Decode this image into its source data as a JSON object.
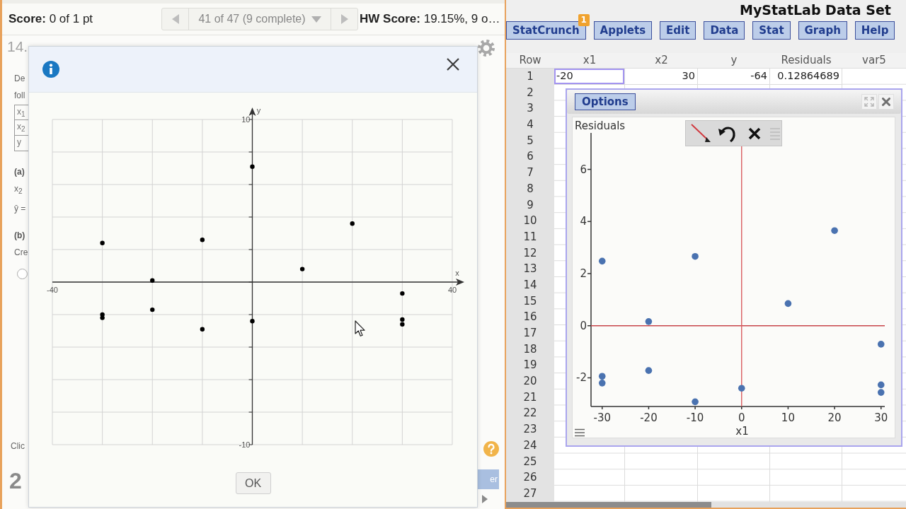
{
  "assignment_bar": {
    "score": "**Score:** 0 of 1 pt",
    "question_picker": "41 of 47 (9 complete)",
    "hw_score": "**HW Score:** 19.15%, 9 o…"
  },
  "question": {
    "number": "14.",
    "items": [
      {
        "kind": "text",
        "text": "De"
      },
      {
        "kind": "text",
        "text": "foll"
      },
      {
        "kind": "table",
        "cells": [
          "x$_{1}$",
          "x$_{2}$",
          "y"
        ]
      },
      {
        "kind": "part",
        "text": "(a)"
      },
      {
        "kind": "text",
        "text": "x$_{2}$"
      },
      {
        "kind": "text",
        "text": "ŷ ="
      },
      {
        "kind": "part",
        "text": "(b)"
      },
      {
        "kind": "text",
        "text": "Cre"
      },
      {
        "kind": "radio",
        "selected": false
      }
    ],
    "footer": {
      "text": "Clic",
      "counter": "2"
    }
  },
  "side_button": "er",
  "dialog": {
    "chart_data": {
      "type": "scatter",
      "xlabel": "x",
      "ylabel": "y",
      "xlim": [
        -40,
        40
      ],
      "ylim": [
        -10,
        10
      ],
      "xticks": [
        -40,
        40
      ],
      "yticks": [
        -10,
        10
      ],
      "grid": true,
      "color": "#000000",
      "x": [
        -30,
        -30,
        -30,
        -20,
        -20,
        -10,
        -10,
        0,
        0,
        10,
        20,
        30,
        30,
        30
      ],
      "values": [
        2.4,
        -2.0,
        -2.2,
        0.1,
        -1.7,
        2.6,
        -2.9,
        7.1,
        -2.4,
        0.8,
        3.6,
        -0.7,
        -2.3,
        -2.6
      ]
    },
    "ok_button": "OK"
  },
  "statcrunch": {
    "title": "MyStatLab Data Set",
    "menu": [
      {
        "label": "StatCrunch",
        "badge": "1"
      },
      {
        "label": "Applets"
      },
      {
        "label": "Edit"
      },
      {
        "label": "Data"
      },
      {
        "label": "Stat"
      },
      {
        "label": "Graph"
      },
      {
        "label": "Help"
      }
    ],
    "sheet": {
      "row_header": "Row",
      "columns": [
        "x1",
        "x2",
        "y",
        "Residuals",
        "var5"
      ],
      "rows": [
        {
          "number": "1",
          "cells": [
            {
              "text": "-20",
              "selected": true
            },
            {
              "text": "30",
              "selected": false
            },
            {
              "text": "-64",
              "selected": false
            },
            {
              "text": "0.12864689",
              "selected": false
            }
          ]
        },
        {
          "number": "2"
        },
        {
          "number": "3"
        },
        {
          "number": "4"
        },
        {
          "number": "5"
        },
        {
          "number": "6"
        },
        {
          "number": "7"
        },
        {
          "number": "8"
        },
        {
          "number": "9"
        },
        {
          "number": "10"
        },
        {
          "number": "11"
        },
        {
          "number": "12"
        },
        {
          "number": "13"
        },
        {
          "number": "14"
        },
        {
          "number": "15"
        },
        {
          "number": "16"
        },
        {
          "number": "17"
        },
        {
          "number": "18"
        },
        {
          "number": "19"
        },
        {
          "number": "20"
        },
        {
          "number": "21"
        },
        {
          "number": "22"
        },
        {
          "number": "23"
        },
        {
          "number": "24"
        },
        {
          "number": "25"
        },
        {
          "number": "26"
        },
        {
          "number": "27"
        }
      ]
    },
    "graph_window": {
      "options_button": "Options",
      "chart_data": {
        "type": "scatter",
        "xlabel": "x1",
        "ylabel": "Residuals",
        "xlim": [
          -32.4,
          30.8
        ],
        "ylim": [
          -3.1,
          7.4
        ],
        "xticks": [
          -30,
          -20,
          -10,
          0,
          10,
          20,
          30
        ],
        "yticks": [
          -2,
          0,
          2,
          4,
          6
        ],
        "color": "#4a72b0",
        "x": [
          -30,
          -30,
          -30,
          -20,
          -20,
          -10,
          -10,
          0,
          10,
          20,
          30,
          30,
          30
        ],
        "values": [
          2.48,
          -1.94,
          -2.2,
          0.16,
          -1.72,
          2.66,
          -2.92,
          -2.4,
          0.85,
          3.65,
          -0.71,
          -2.27,
          -2.56
        ],
        "ref_lines": [
          {
            "axis": "y",
            "value": 0,
            "color": "#c8464b"
          },
          {
            "axis": "x",
            "value": 0,
            "color": "#d95c60"
          }
        ]
      }
    }
  }
}
